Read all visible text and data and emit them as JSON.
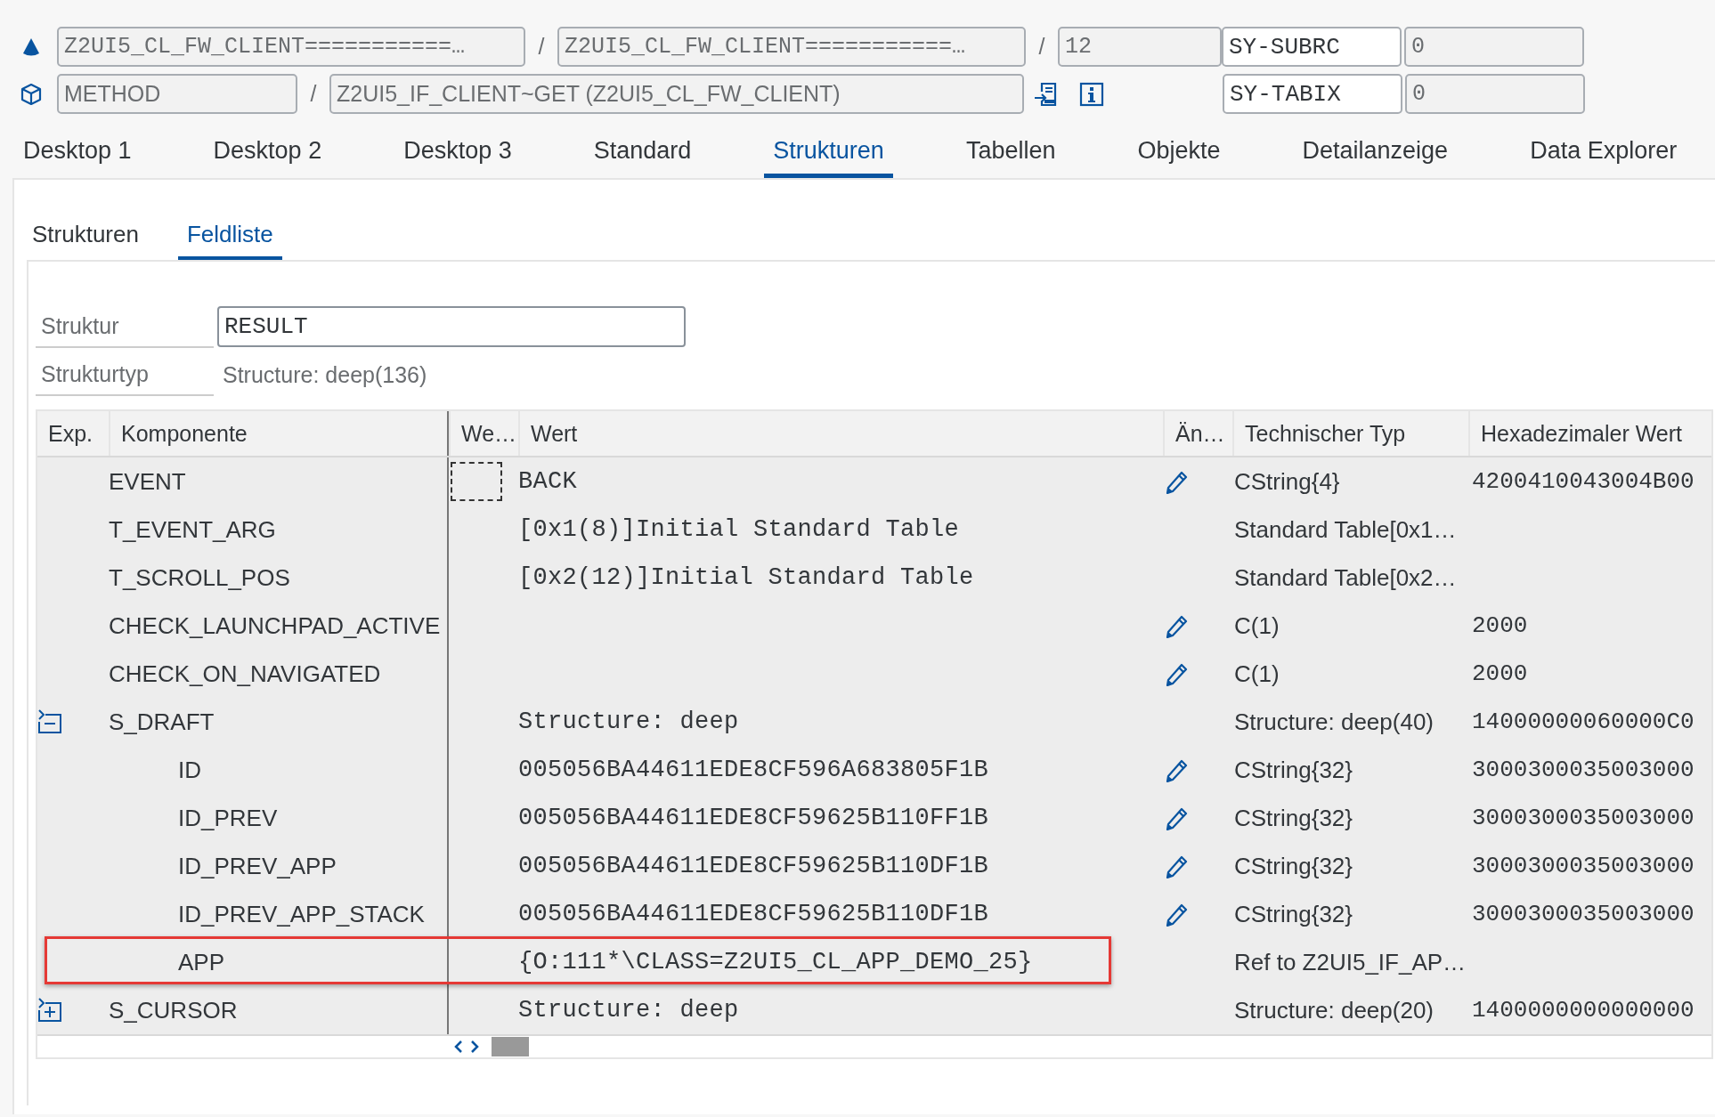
{
  "header": {
    "rows": [
      {
        "items": [
          {
            "kind": "field",
            "text": "Z2UI5_CL_FW_CLIENT===========…"
          },
          {
            "kind": "sep",
            "text": "/"
          },
          {
            "kind": "field",
            "text": "Z2UI5_CL_FW_CLIENT===========…"
          },
          {
            "kind": "sep",
            "text": "/"
          },
          {
            "kind": "short",
            "text": "12"
          },
          {
            "kind": "sysname",
            "text": "SY-SUBRC"
          },
          {
            "kind": "sysvalue",
            "text": "0"
          }
        ]
      },
      {
        "items": [
          {
            "kind": "label",
            "text": "METHOD"
          },
          {
            "kind": "sep",
            "text": "/"
          },
          {
            "kind": "name",
            "text": "Z2UI5_IF_CLIENT~GET (Z2UI5_CL_FW_CLIENT)"
          },
          {
            "kind": "tools"
          },
          {
            "kind": "sysname",
            "text": "SY-TABIX"
          },
          {
            "kind": "sysvalue",
            "text": "0"
          }
        ]
      }
    ]
  },
  "tabs": [
    {
      "label": "Desktop 1",
      "selected": false
    },
    {
      "label": "Desktop 2",
      "selected": false
    },
    {
      "label": "Desktop 3",
      "selected": false
    },
    {
      "label": "Standard",
      "selected": false
    },
    {
      "label": "Strukturen",
      "selected": true
    },
    {
      "label": "Tabellen",
      "selected": false
    },
    {
      "label": "Objekte",
      "selected": false
    },
    {
      "label": "Detailanzeige",
      "selected": false
    },
    {
      "label": "Data Explorer",
      "selected": false
    }
  ],
  "subtabs": [
    {
      "label": "Strukturen",
      "selected": false
    },
    {
      "label": "Feldliste",
      "selected": true
    }
  ],
  "structure": {
    "label": "Struktur",
    "value": "RESULT",
    "type_label": "Strukturtyp",
    "type_value": "Structure: deep(136)"
  },
  "table": {
    "columns": [
      "Exp.",
      "Komponente",
      "We…",
      "Wert",
      "Än…",
      "Technischer Typ",
      "Hexadezimaler Wert"
    ],
    "rows": [
      {
        "component": "EVENT",
        "value": "BACK",
        "editable": true,
        "type": "CString{4}",
        "hex": "4200410043004B00",
        "focused": true,
        "highlighted": false
      },
      {
        "component": "T_EVENT_ARG",
        "value": "[0x1(8)]Initial Standard Table",
        "editable": false,
        "type": "Standard Table[0x1…",
        "focused": false,
        "highlighted": false
      },
      {
        "component": "T_SCROLL_POS",
        "value": "[0x2(12)]Initial Standard Table",
        "editable": false,
        "type": "Standard Table[0x2…",
        "focused": false,
        "highlighted": false
      },
      {
        "component": "CHECK_LAUNCHPAD_ACTIVE",
        "editable": true,
        "type": "C(1)",
        "hex": "2000",
        "focused": false,
        "highlighted": false
      },
      {
        "component": "CHECK_ON_NAVIGATED",
        "editable": true,
        "type": "C(1)",
        "hex": "2000",
        "focused": false,
        "highlighted": false
      },
      {
        "component": "S_DRAFT",
        "value": "Structure: deep",
        "editable": false,
        "type": "Structure: deep(40)",
        "hex": "14000000060000C0",
        "focused": false,
        "highlighted": false,
        "expanded": true,
        "children": [
          {
            "component": "ID",
            "value": "005056BA44611EDE8CF596A683805F1B",
            "editable": true,
            "type": "CString{32}",
            "hex": "3000300035003000",
            "focused": false,
            "highlighted": false
          },
          {
            "component": "ID_PREV",
            "value": "005056BA44611EDE8CF59625B110FF1B",
            "editable": true,
            "type": "CString{32}",
            "hex": "3000300035003000",
            "focused": false,
            "highlighted": false
          },
          {
            "component": "ID_PREV_APP",
            "value": "005056BA44611EDE8CF59625B110DF1B",
            "editable": true,
            "type": "CString{32}",
            "hex": "3000300035003000",
            "focused": false,
            "highlighted": false
          },
          {
            "component": "ID_PREV_APP_STACK",
            "value": "005056BA44611EDE8CF59625B110DF1B",
            "editable": true,
            "type": "CString{32}",
            "hex": "3000300035003000",
            "focused": false,
            "highlighted": false
          },
          {
            "component": "APP",
            "value": "{O:111*\\CLASS=Z2UI5_CL_APP_DEMO_25}",
            "editable": false,
            "type": "Ref to Z2UI5_IF_AP…",
            "focused": false,
            "highlighted": true
          }
        ]
      },
      {
        "component": "S_CURSOR",
        "value": "Structure: deep",
        "editable": false,
        "type": "Structure: deep(20)",
        "hex": "1400000000000000",
        "focused": false,
        "highlighted": false,
        "expanded": false
      }
    ]
  }
}
